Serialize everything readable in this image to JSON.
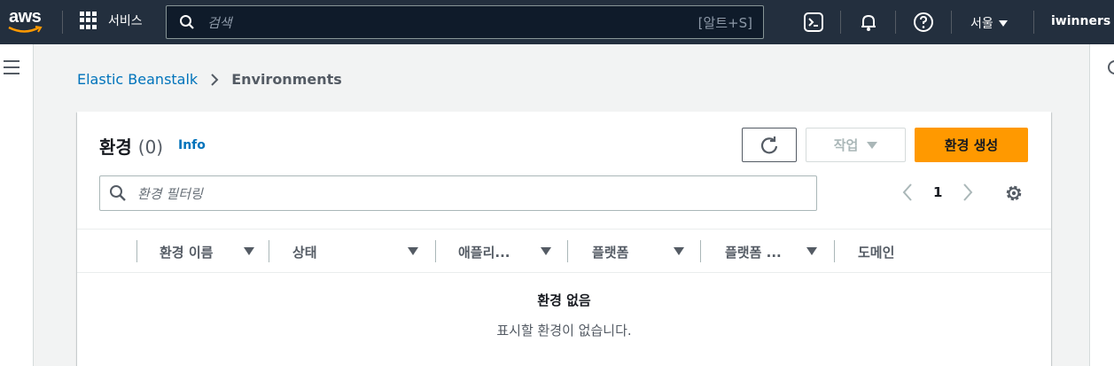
{
  "topnav": {
    "logo_text": "aws",
    "services_label": "서비스",
    "search_placeholder": "검색",
    "search_shortcut": "[알트+S]",
    "region": "서울",
    "user": "iwinners"
  },
  "breadcrumb": {
    "parent": "Elastic Beanstalk",
    "current": "Environments"
  },
  "panel": {
    "title": "환경",
    "count": "(0)",
    "info_label": "Info",
    "actions_label": "작업",
    "create_label": "환경 생성",
    "filter_placeholder": "환경 필터링",
    "page_number": "1"
  },
  "table": {
    "columns": [
      "환경 이름",
      "상태",
      "애플리...",
      "플랫폼",
      "플랫폼 ...",
      "도메인"
    ]
  },
  "empty_state": {
    "title": "환경 없음",
    "description": "표시할 환경이 없습니다."
  },
  "colors": {
    "nav_bg": "#232f3e",
    "primary_button": "#ff9900",
    "link": "#0073bb"
  }
}
